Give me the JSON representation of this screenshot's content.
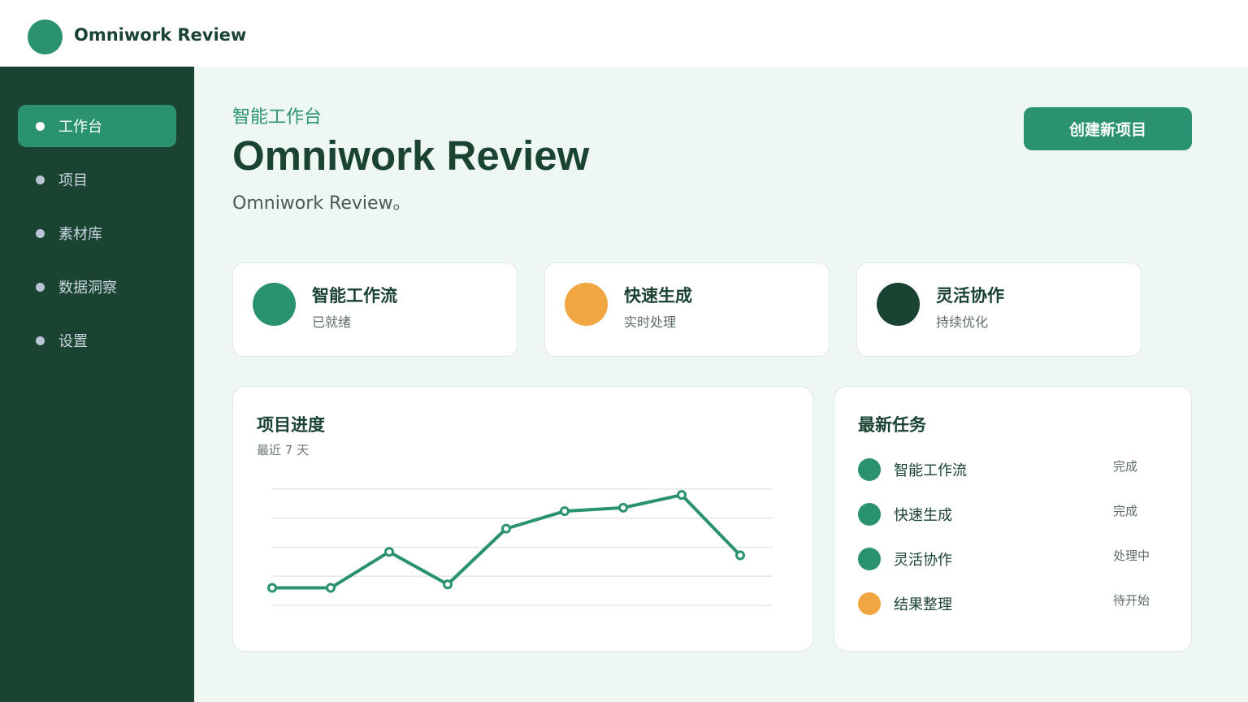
{
  "app": {
    "brand": "Omniwork Review"
  },
  "sidebar": {
    "items": [
      {
        "label": "工作台",
        "active": true
      },
      {
        "label": "项目",
        "active": false
      },
      {
        "label": "素材库",
        "active": false
      },
      {
        "label": "数据洞察",
        "active": false
      },
      {
        "label": "设置",
        "active": false
      }
    ]
  },
  "header": {
    "eyebrow": "智能工作台",
    "title": "Omniwork Review",
    "subtitle": "Omniwork Review。",
    "create_label": "创建新项目"
  },
  "features": [
    {
      "title": "智能工作流",
      "sub": "已就绪",
      "color": "#2a9270"
    },
    {
      "title": "快速生成",
      "sub": "实时处理",
      "color": "#f2a641"
    },
    {
      "title": "灵活协作",
      "sub": "持续优化",
      "color": "#1b4332"
    }
  ],
  "progress": {
    "title": "项目进度",
    "subtitle": "最近 7 天"
  },
  "chart_data": {
    "type": "line",
    "title": "项目进度",
    "subtitle": "最近 7 天",
    "xlabel": "",
    "ylabel": "",
    "ylim": [
      0,
      100
    ],
    "grid": true,
    "color": "#2a9270",
    "series": [
      {
        "values": [
          15,
          15,
          46,
          18,
          66,
          81,
          84,
          95,
          43
        ]
      }
    ]
  },
  "tasks": {
    "title": "最新任务",
    "items": [
      {
        "label": "智能工作流",
        "status": "完成",
        "color": "#2a9270"
      },
      {
        "label": "快速生成",
        "status": "完成",
        "color": "#2a9270"
      },
      {
        "label": "灵活协作",
        "status": "处理中",
        "color": "#2a9270"
      },
      {
        "label": "结果整理",
        "status": "待开始",
        "color": "#f2a641"
      }
    ]
  }
}
